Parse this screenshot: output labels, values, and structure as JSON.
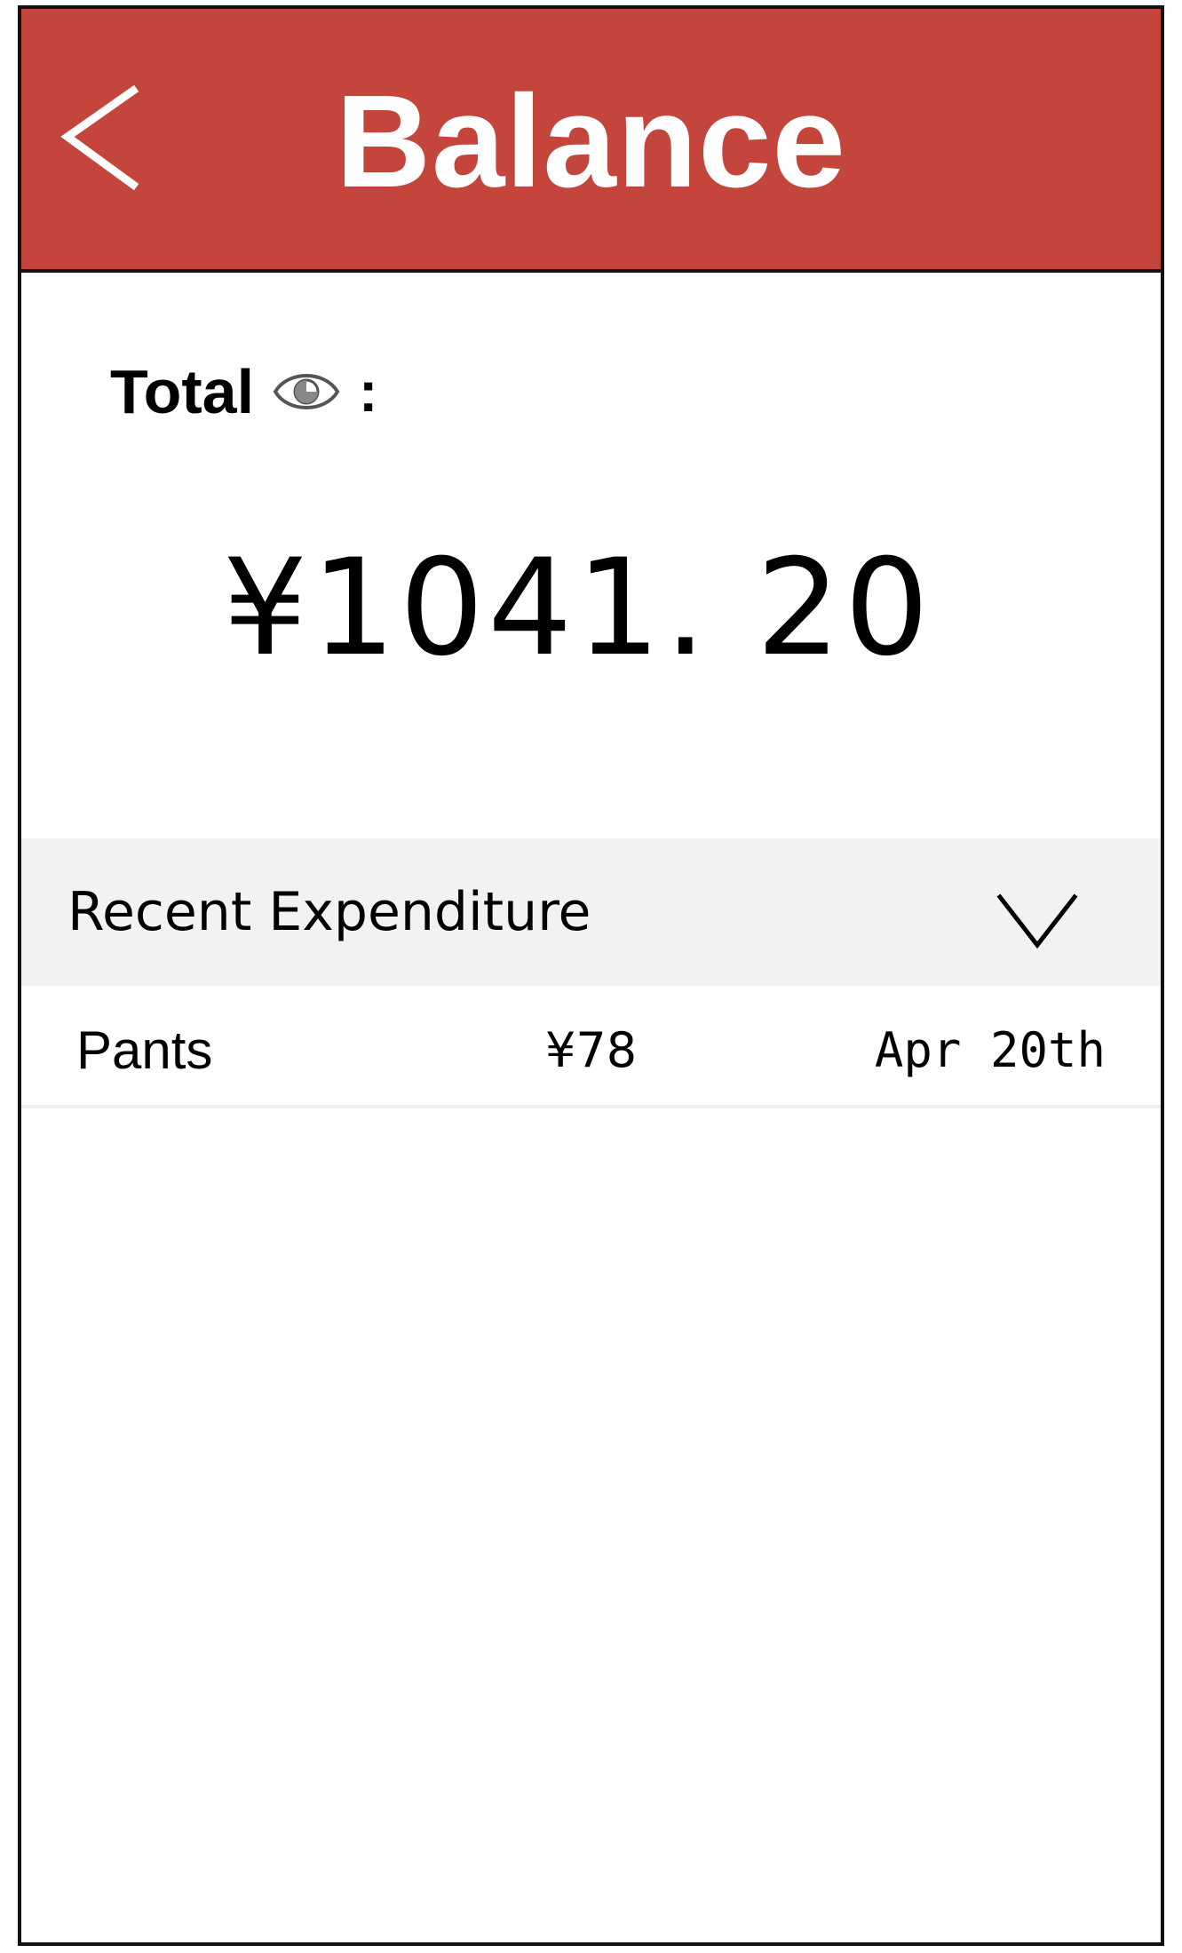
{
  "colors": {
    "header_bg": "#c3453b",
    "section_bg": "#f2f2f2",
    "text": "#000000",
    "frame": "#111111"
  },
  "header": {
    "title": "Balance",
    "back_icon": "chevron-left-icon"
  },
  "summary": {
    "total_label": "Total",
    "visibility_icon": "eye-icon",
    "colon": ":",
    "amount": "¥1041. 20"
  },
  "recent": {
    "title": "Recent Expenditure",
    "toggle_icon": "chevron-down-icon",
    "items": [
      {
        "name": "Pants",
        "amount": "¥78",
        "date": "Apr 20th"
      }
    ]
  }
}
